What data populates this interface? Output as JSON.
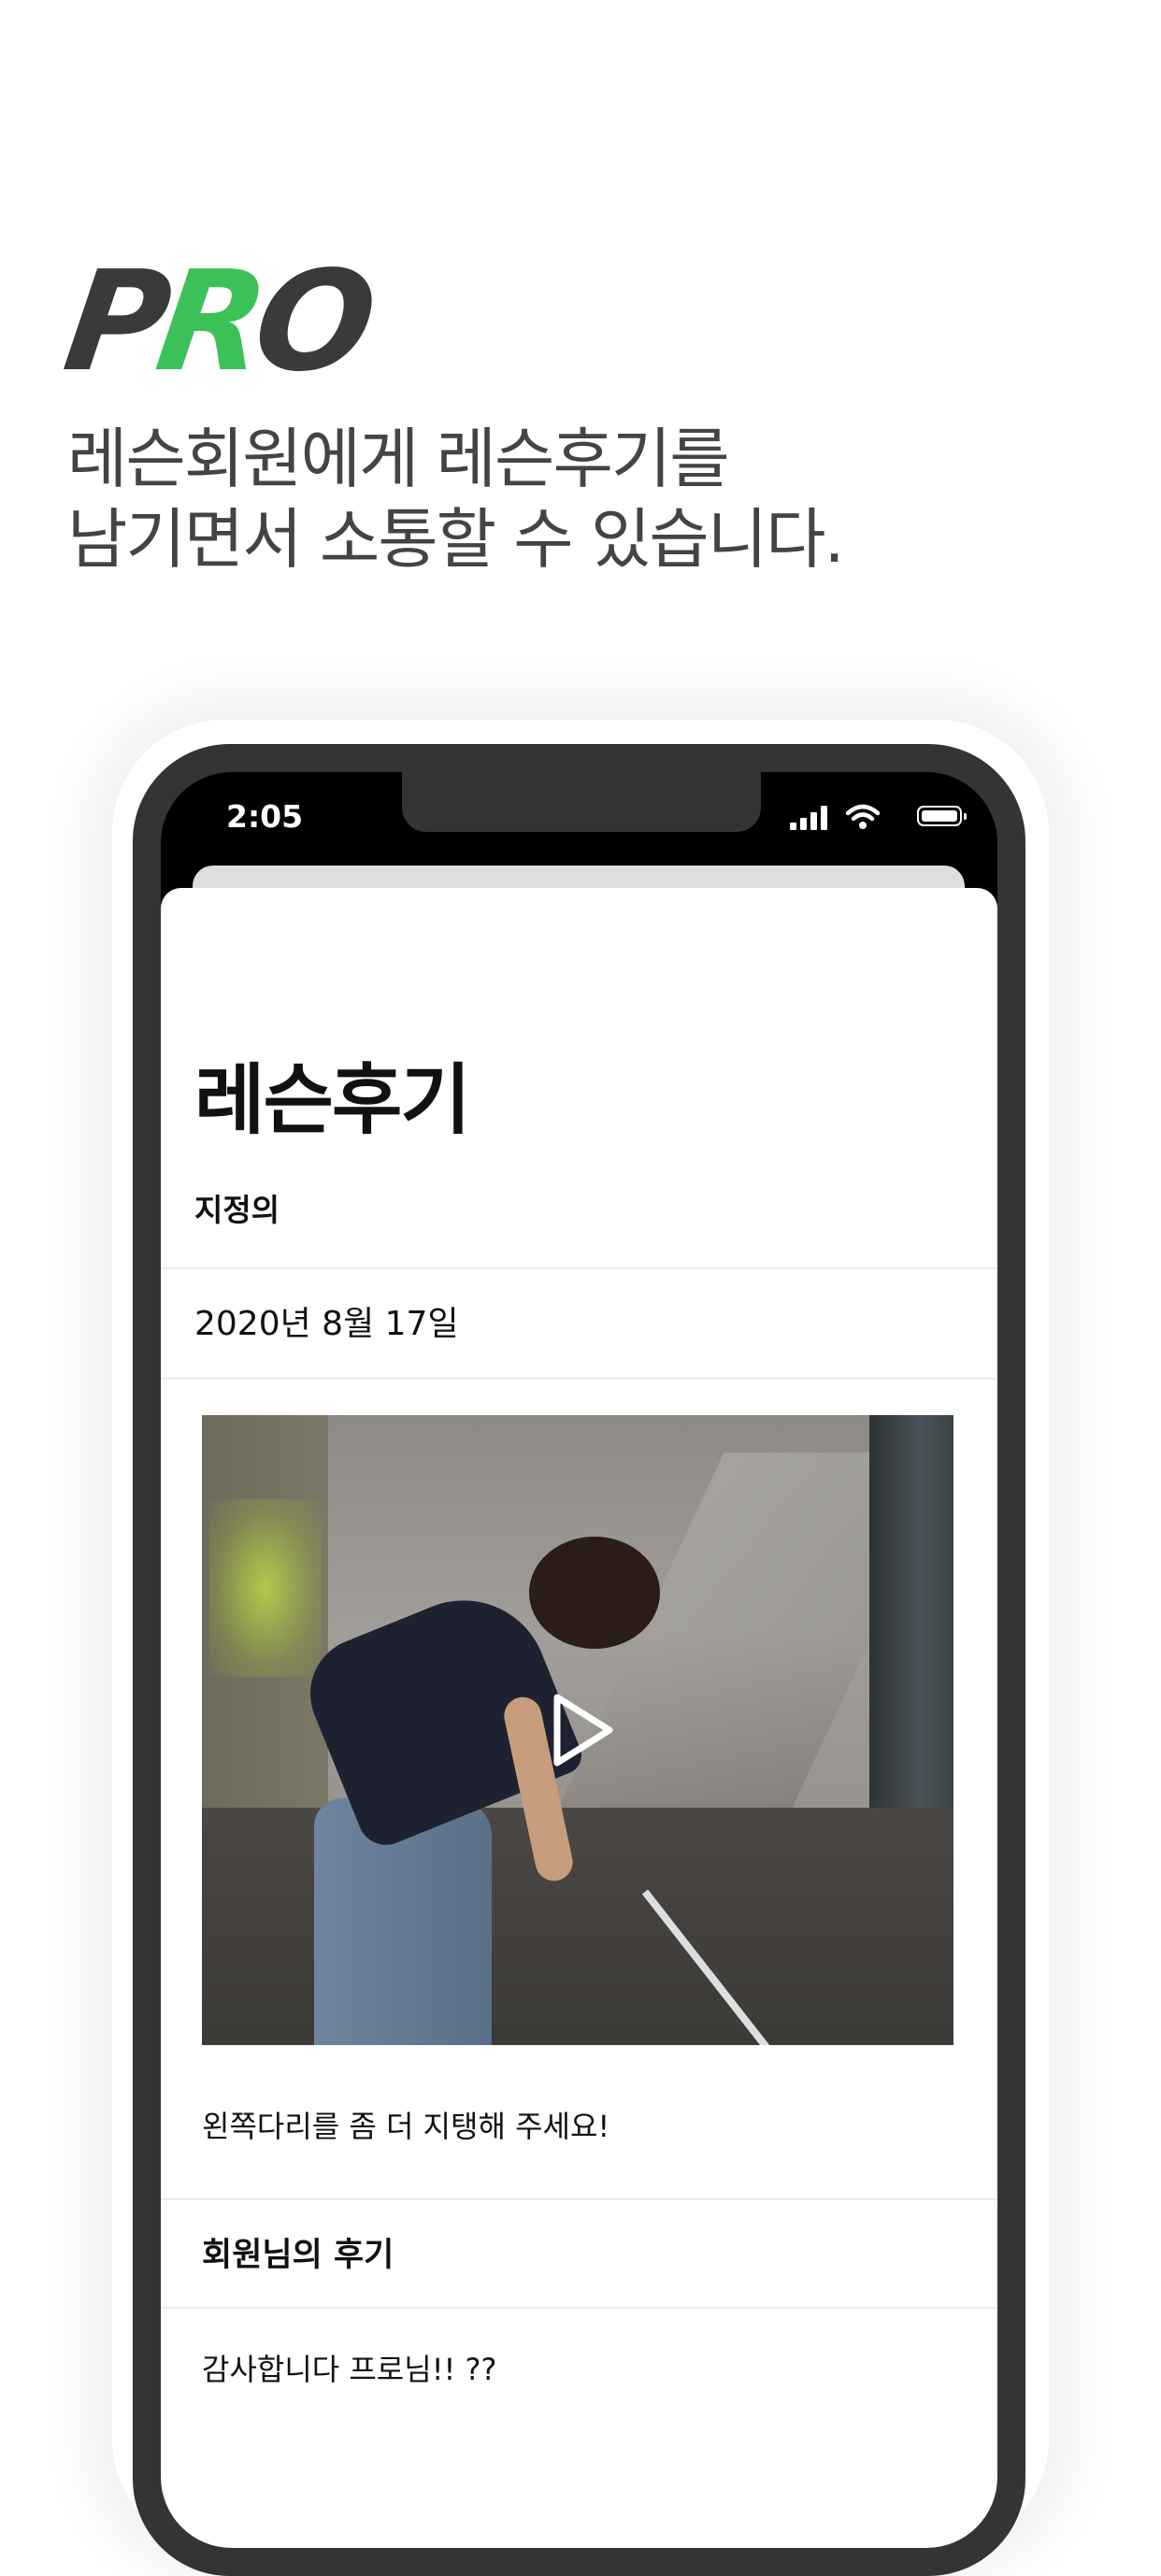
{
  "brand": {
    "logo_p": "P",
    "logo_r": "R",
    "logo_o": "O",
    "accent_color": "#3cc158",
    "dark_color": "#3a3a3a"
  },
  "headline": {
    "line1": "레슨회원에게 레슨후기를",
    "line2": "남기면서 소통할 수 있습니다."
  },
  "status_bar": {
    "time": "2:05",
    "icons": [
      "cellular-signal-icon",
      "wifi-icon",
      "battery-icon"
    ]
  },
  "screen": {
    "title": "레슨후기",
    "coach_name": "지정의",
    "lesson_date": "2020년 8월 17일",
    "video": {
      "play_icon": "play-icon"
    },
    "lesson_comment": "왼쪽다리를 좀 더 지탱해 주세요!",
    "review_heading": "회원님의 후기",
    "member_review": "감사합니다 프로님!! ??"
  }
}
